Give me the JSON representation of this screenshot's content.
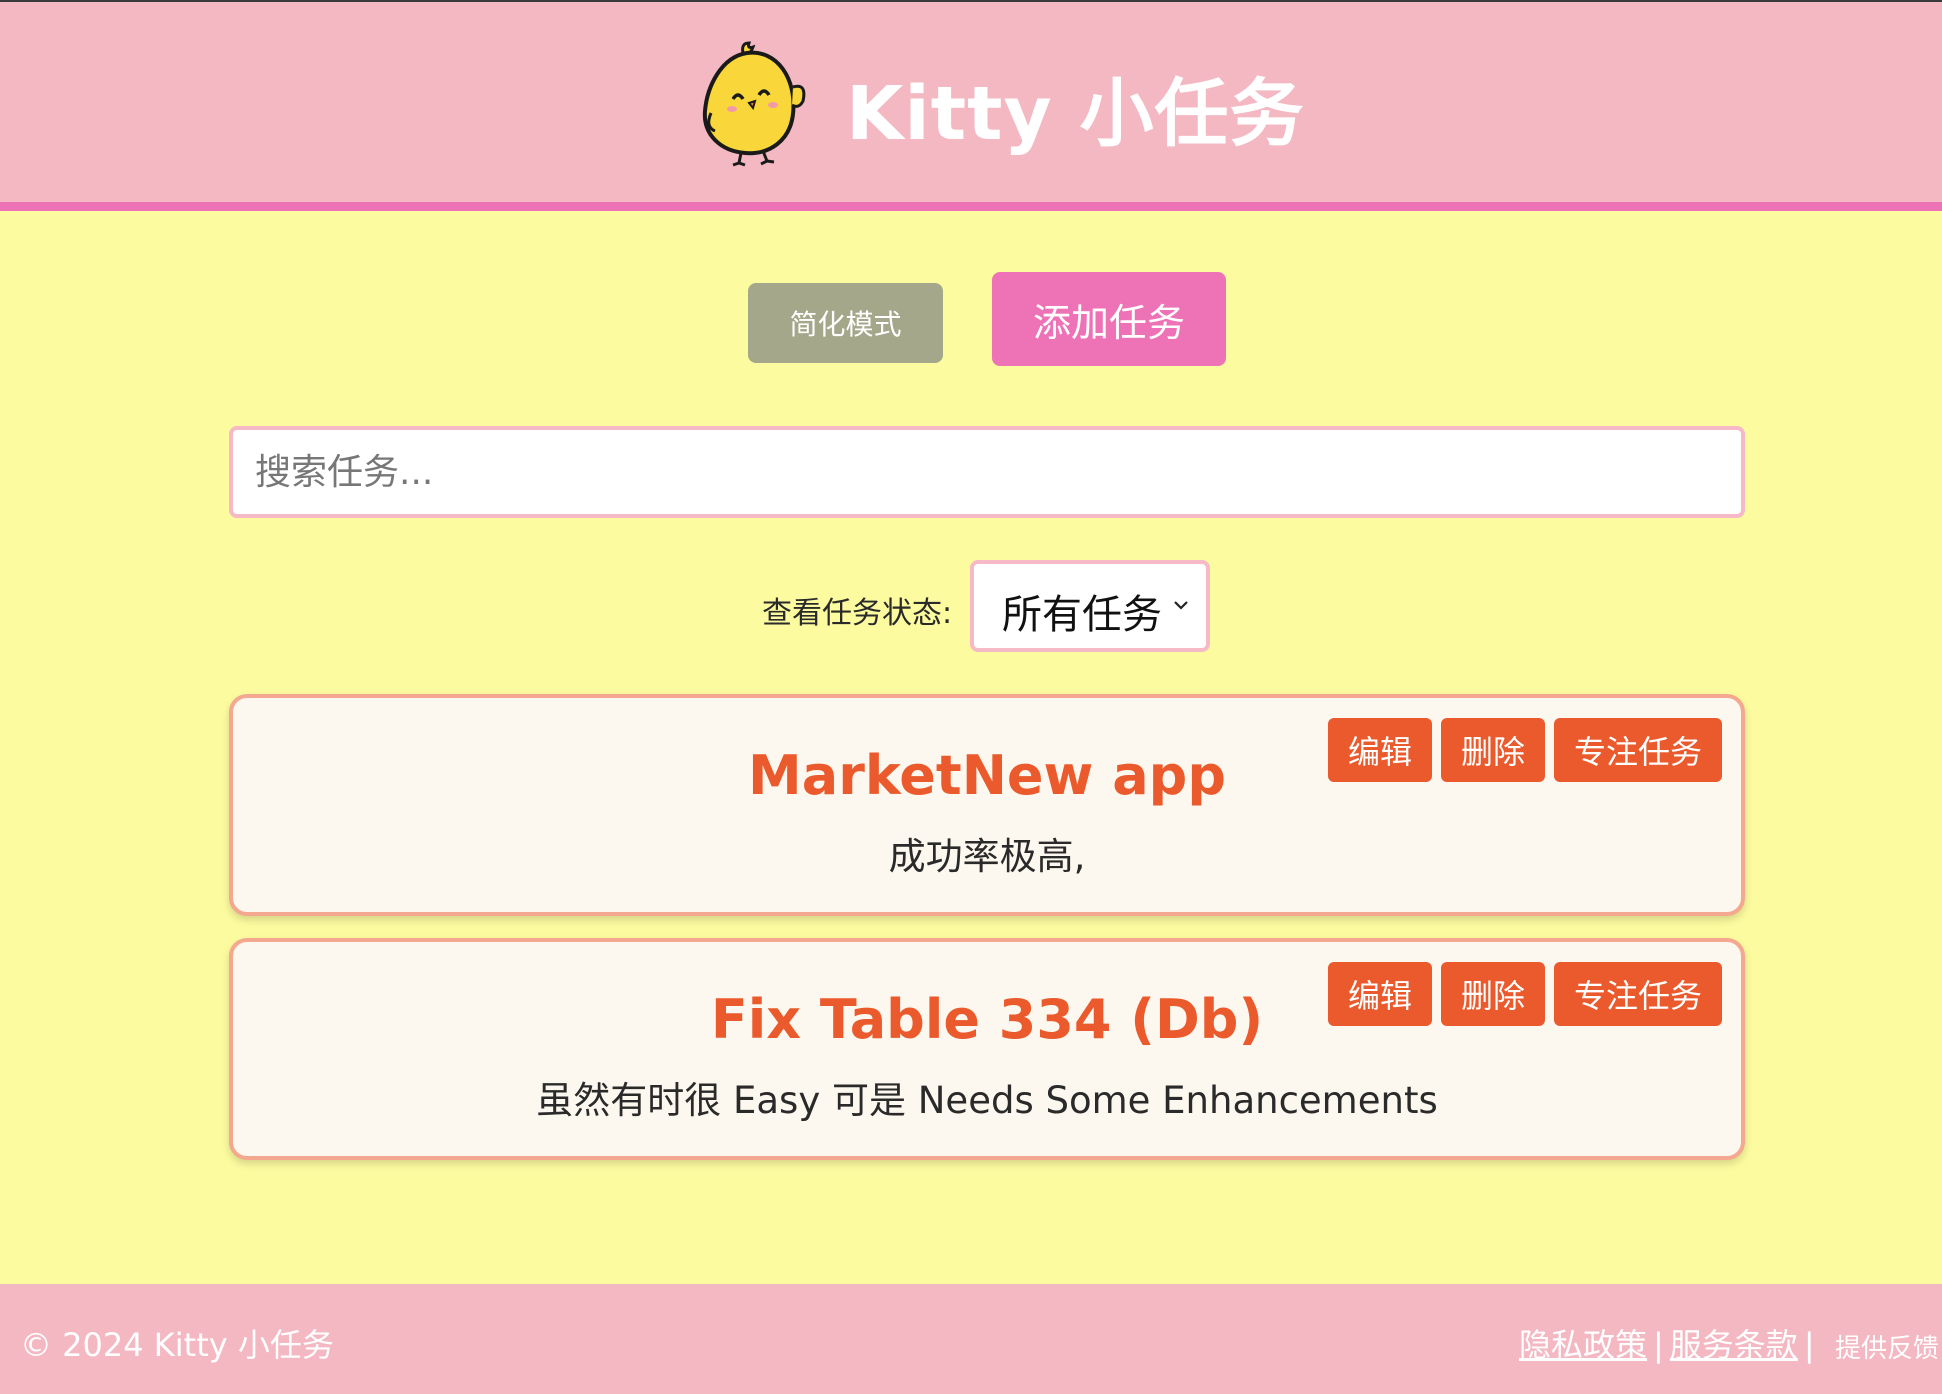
{
  "header": {
    "app_title": "Kitty 小任务",
    "logo_icon": "chick-mascot-icon"
  },
  "toolbar": {
    "simple_mode_label": "简化模式",
    "add_task_label": "添加任务"
  },
  "search": {
    "placeholder": "搜索任务..."
  },
  "filter": {
    "label": "查看任务状态:",
    "selected": "所有任务"
  },
  "tasks": [
    {
      "title": "MarketNew app",
      "description": "成功率极高,",
      "edit_label": "编辑",
      "delete_label": "删除",
      "focus_label": "专注任务"
    },
    {
      "title": "Fix Table 334 (Db)",
      "description": "虽然有时很 Easy 可是 Needs Some Enhancements",
      "edit_label": "编辑",
      "delete_label": "删除",
      "focus_label": "专注任务"
    }
  ],
  "footer": {
    "copyright": "© 2024 Kitty 小任务",
    "privacy_label": "隐私政策",
    "terms_label": "服务条款",
    "separator": "|",
    "feedback_label": "提供反馈"
  },
  "colors": {
    "header_bg": "#f4b8c3",
    "header_border": "#ee72b6",
    "page_bg": "#fcfb9f",
    "accent": "#ea5a2c",
    "add_button": "#ee72b6",
    "simple_button": "#a4a78a"
  }
}
